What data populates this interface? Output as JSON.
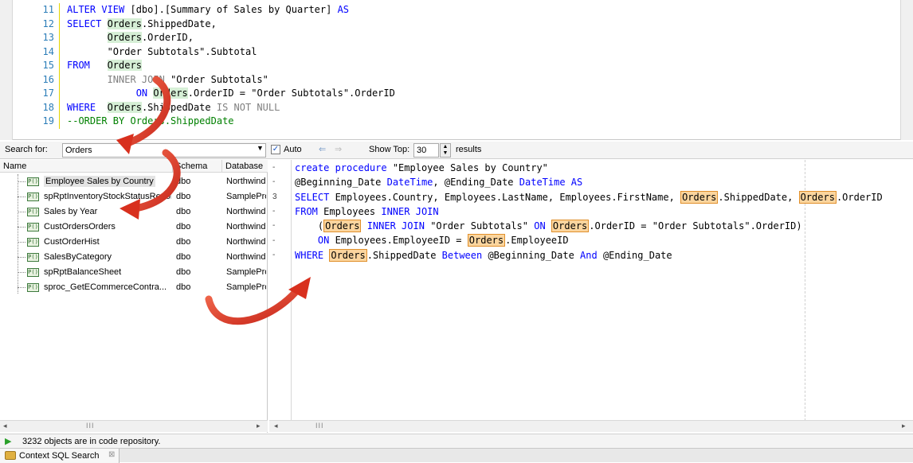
{
  "top_editor": {
    "lines": [
      {
        "n": "11",
        "parts": [
          [
            "kw",
            "ALTER VIEW "
          ],
          [
            "t",
            "[dbo].[Summary of Sales by Quarter] "
          ],
          [
            "kw",
            "AS"
          ]
        ]
      },
      {
        "n": "12",
        "parts": [
          [
            "kw",
            "SELECT "
          ],
          [
            "hl2",
            "Orders"
          ],
          [
            "t",
            ".ShippedDate,"
          ]
        ]
      },
      {
        "n": "13",
        "parts": [
          [
            "t",
            "       "
          ],
          [
            "hl2",
            "Orders"
          ],
          [
            "t",
            ".OrderID,"
          ]
        ]
      },
      {
        "n": "14",
        "parts": [
          [
            "t",
            "       \"Order Subtotals\".Subtotal"
          ]
        ]
      },
      {
        "n": "15",
        "parts": [
          [
            "kw",
            "FROM   "
          ],
          [
            "hl2",
            "Orders"
          ]
        ]
      },
      {
        "n": "16",
        "parts": [
          [
            "t",
            "       "
          ],
          [
            "gy",
            "INNER JOIN "
          ],
          [
            "t",
            "\"Order Subtotals\""
          ]
        ]
      },
      {
        "n": "17",
        "parts": [
          [
            "t",
            "            "
          ],
          [
            "kw",
            "ON "
          ],
          [
            "hl2",
            "Orders"
          ],
          [
            "t",
            ".OrderID = \"Order Subtotals\".OrderID"
          ]
        ]
      },
      {
        "n": "18",
        "parts": [
          [
            "kw",
            "WHERE  "
          ],
          [
            "hl2",
            "Orders"
          ],
          [
            "t",
            ".ShippedDate "
          ],
          [
            "gy",
            "IS NOT NULL"
          ]
        ]
      },
      {
        "n": "19",
        "parts": [
          [
            "cm",
            "--ORDER BY Orders.ShippedDate"
          ]
        ]
      }
    ]
  },
  "toolbar": {
    "search_label": "Search for:",
    "search_value": "Orders",
    "auto_label": "Auto",
    "show_top_label": "Show Top:",
    "show_top_value": "30",
    "results_label": "results"
  },
  "table": {
    "headers": {
      "name": "Name",
      "schema": "Schema",
      "database": "Database"
    },
    "rows": [
      {
        "name": "Employee Sales by Country",
        "schema": "dbo",
        "database": "Northwind",
        "selected": true
      },
      {
        "name": "spRptInventoryStockStatusReport",
        "schema": "dbo",
        "database": "SamplePro"
      },
      {
        "name": "Sales by Year",
        "schema": "dbo",
        "database": "Northwind"
      },
      {
        "name": "CustOrdersOrders",
        "schema": "dbo",
        "database": "Northwind"
      },
      {
        "name": "CustOrderHist",
        "schema": "dbo",
        "database": "Northwind"
      },
      {
        "name": "SalesByCategory",
        "schema": "dbo",
        "database": "Northwind"
      },
      {
        "name": "spRptBalanceSheet",
        "schema": "dbo",
        "database": "SamplePro"
      },
      {
        "name": "sproc_GetECommerceContra...",
        "schema": "dbo",
        "database": "SamplePro"
      }
    ],
    "icon_text": "P()"
  },
  "gutter_marks": [
    "-",
    "-",
    "3",
    "-",
    "-",
    "-",
    "-"
  ],
  "procedure": {
    "lines": [
      [
        [
          "kw",
          "create procedure "
        ],
        [
          "t",
          "\"Employee Sales by Country\""
        ]
      ],
      [
        [
          "t",
          "@Beginning_Date "
        ],
        [
          "kw",
          "DateTime"
        ],
        [
          "t",
          ", @Ending_Date "
        ],
        [
          "kw",
          "DateTime AS"
        ]
      ],
      [
        [
          "kw",
          "SELECT "
        ],
        [
          "t",
          "Employees.Country, Employees.LastName, Employees.FirstName, "
        ],
        [
          "hl",
          "Orders"
        ],
        [
          "t",
          ".ShippedDate, "
        ],
        [
          "hl",
          "Orders"
        ],
        [
          "t",
          ".OrderID"
        ]
      ],
      [
        [
          "kw",
          "FROM "
        ],
        [
          "t",
          "Employees "
        ],
        [
          "kw",
          "INNER JOIN"
        ]
      ],
      [
        [
          "t",
          "    ("
        ],
        [
          "hl",
          "Orders"
        ],
        [
          "kw",
          " INNER JOIN "
        ],
        [
          "t",
          "\"Order Subtotals\" "
        ],
        [
          "kw",
          "ON "
        ],
        [
          "hl",
          "Orders"
        ],
        [
          "t",
          ".OrderID = \"Order Subtotals\".OrderID)"
        ]
      ],
      [
        [
          "t",
          "    "
        ],
        [
          "kw",
          "ON "
        ],
        [
          "t",
          "Employees.EmployeeID = "
        ],
        [
          "hl",
          "Orders"
        ],
        [
          "t",
          ".EmployeeID"
        ]
      ],
      [
        [
          "kw",
          "WHERE "
        ],
        [
          "hl",
          "Orders"
        ],
        [
          "t",
          ".ShippedDate "
        ],
        [
          "kw",
          "Between "
        ],
        [
          "t",
          "@Beginning_Date "
        ],
        [
          "kw",
          "And "
        ],
        [
          "t",
          "@Ending_Date"
        ]
      ]
    ]
  },
  "status": {
    "text": "3232 objects are in code repository."
  },
  "tab": {
    "label": "Context SQL Search",
    "close": "⊠"
  },
  "scroll": {
    "left": "◂",
    "right": "▸",
    "grip": "III"
  },
  "icons": {
    "play": "▶",
    "checkmark": "✓",
    "dropdown": "▼",
    "nav_prev": "⇐",
    "nav_next": "⇒"
  },
  "colors": {
    "keyword": "#0000ff",
    "highlight": "#fbd59e",
    "arrow": "#e8412c"
  }
}
